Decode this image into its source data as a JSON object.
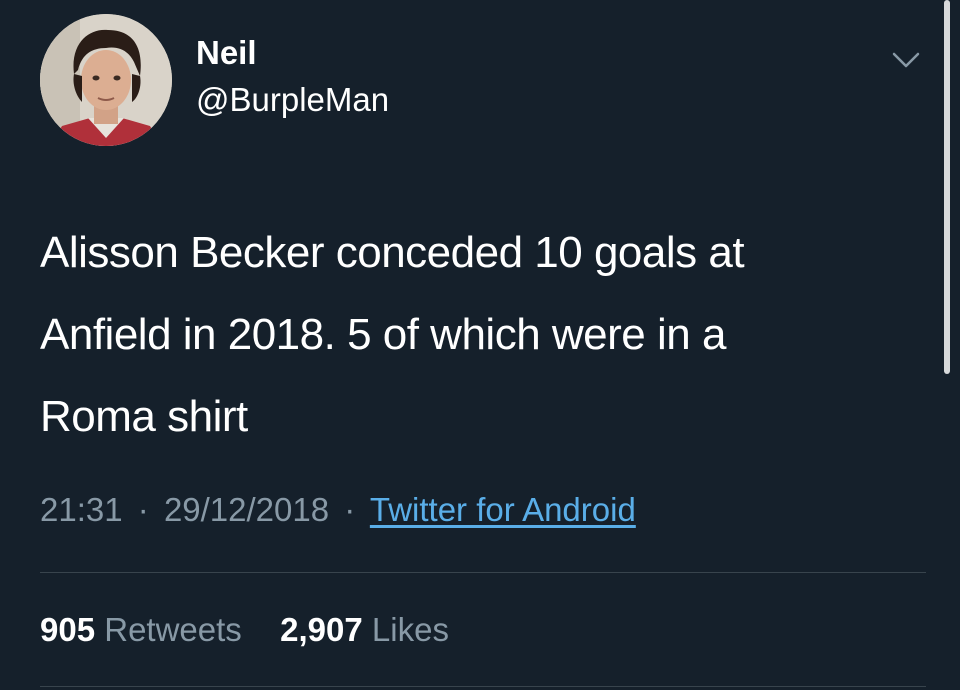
{
  "user": {
    "display_name": "Neil",
    "handle": "@BurpleMan"
  },
  "tweet": {
    "lines": [
      "Alisson Becker conceded 10 goals at",
      "Anfield in 2018. 5 of which were in a",
      "Roma shirt"
    ]
  },
  "meta": {
    "time": "21:31",
    "separator": "·",
    "date": "29/12/2018",
    "source": "Twitter for Android"
  },
  "stats": {
    "retweets_count": "905",
    "retweets_label": "Retweets",
    "likes_count": "2,907",
    "likes_label": "Likes"
  },
  "icons": {
    "menu": "chevron-down-icon"
  },
  "colors": {
    "background": "#15202b",
    "secondary_text": "#8899a6",
    "link": "#5aaee8",
    "divider": "#38444d"
  }
}
